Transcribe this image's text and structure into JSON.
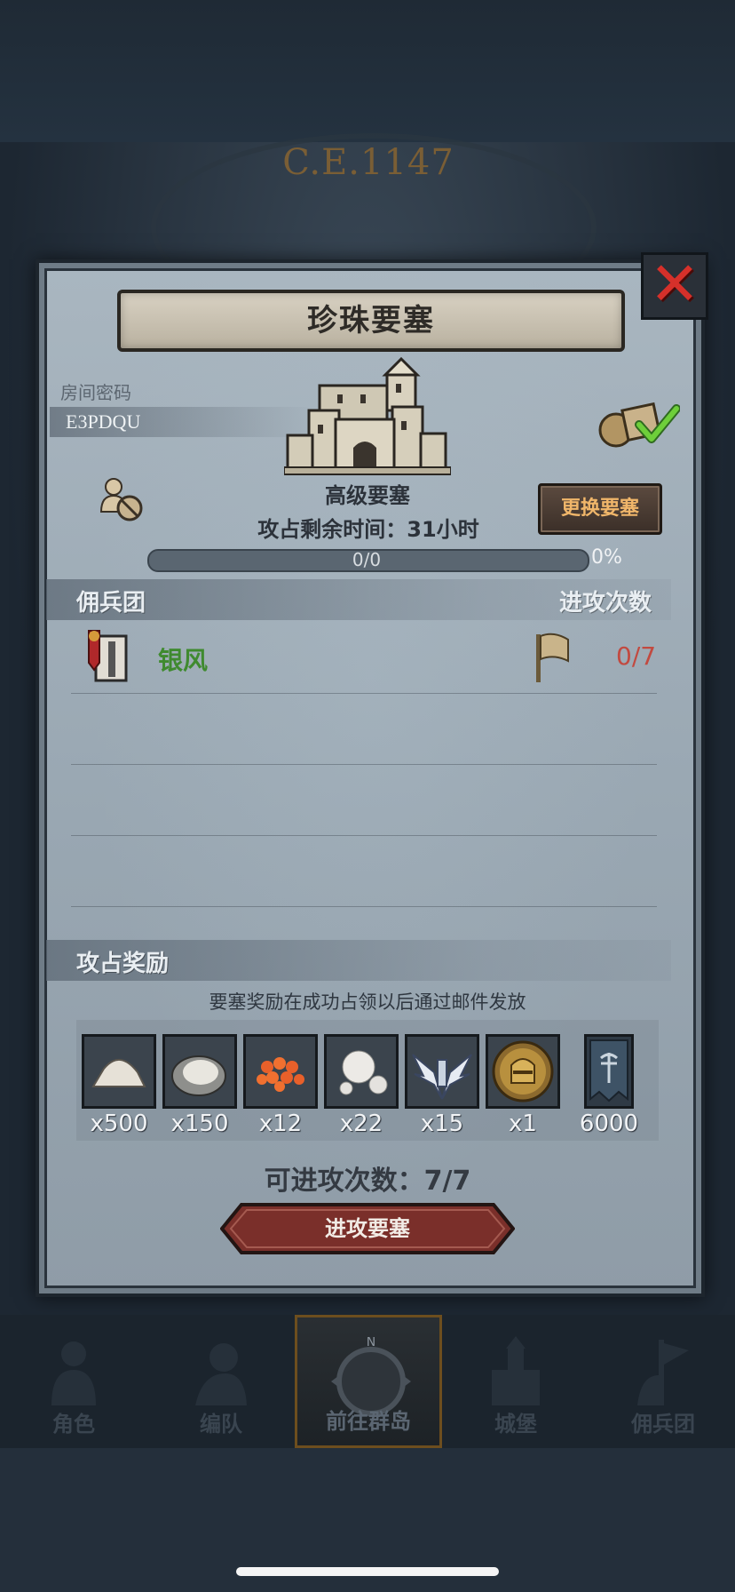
{
  "background": {
    "era_label": "C.E.1147"
  },
  "dialog": {
    "title": "珍珠要塞",
    "close_icon": "close-x-icon",
    "room_code_label": "房间密码",
    "room_code": "E3PDQU",
    "fortress_level": "高级要塞",
    "change_fortress_label": "更换要塞",
    "time_remaining_text": "攻占剩余时间：31小时",
    "progress": {
      "text": "0/0",
      "percent_text": "0%",
      "value": 0
    },
    "mercenary_section": {
      "title": "佣兵团",
      "attack_count_header": "进攻次数",
      "rows": [
        {
          "name": "银风",
          "attack_count": "0/7"
        }
      ]
    },
    "rewards_section": {
      "title": "攻占奖励",
      "note": "要塞奖励在成功占领以后通过邮件发放",
      "items": [
        {
          "icon": "salt-pile-icon",
          "count": "x500"
        },
        {
          "icon": "oyster-icon",
          "count": "x150"
        },
        {
          "icon": "fish-roe-icon",
          "count": "x12"
        },
        {
          "icon": "pearl-icon",
          "count": "x22"
        },
        {
          "icon": "winged-emblem-icon",
          "count": "x15"
        },
        {
          "icon": "knight-helmet-coin-icon",
          "count": "x1"
        },
        {
          "icon": "guild-banner-icon",
          "count": "6000"
        }
      ]
    },
    "attacks_available_text": "可进攻次数：7/7",
    "attack_button_label": "进攻要塞"
  },
  "bottom_nav": {
    "items": [
      {
        "label": "角色",
        "icon": "knight-icon",
        "active": false
      },
      {
        "label": "编队",
        "icon": "formation-icon",
        "active": false
      },
      {
        "label": "前往群岛",
        "icon": "compass-icon",
        "active": true
      },
      {
        "label": "城堡",
        "icon": "castle-icon",
        "active": false
      },
      {
        "label": "佣兵团",
        "icon": "mercenary-icon",
        "active": false
      }
    ]
  },
  "colors": {
    "guild_name": "#3f8a2f",
    "attack_count": "#c24a40",
    "change_button_text": "#f0b66a",
    "close_x": "#d6302a"
  }
}
